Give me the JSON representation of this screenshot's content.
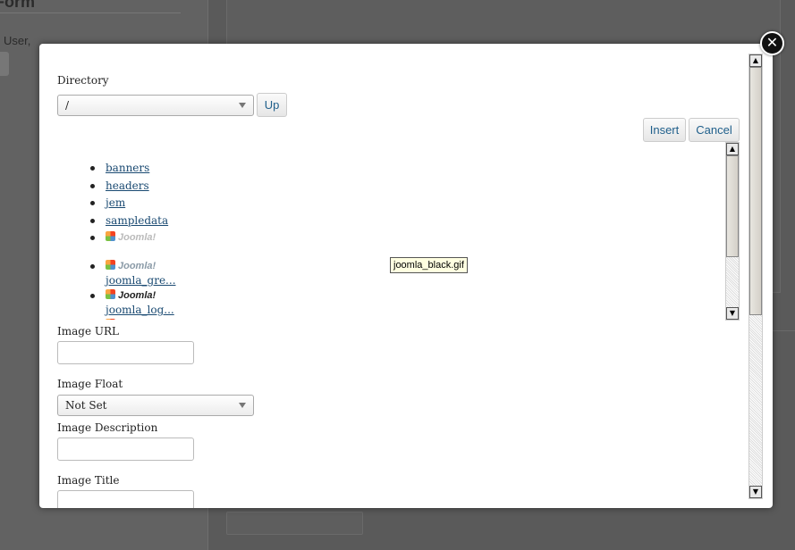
{
  "background": {
    "title": "Form",
    "user_text": "User,"
  },
  "modal": {
    "directory_label": "Directory",
    "directory_value": "/",
    "up_label": "Up",
    "insert_label": "Insert",
    "cancel_label": "Cancel",
    "folders": [
      "banners",
      "headers",
      "jem",
      "sampledata"
    ],
    "images": [
      {
        "name": "joomla_gre...",
        "logo": "Joomla!"
      },
      {
        "name": "joomla_log...",
        "logo": "Joomla!"
      }
    ],
    "logo_text": "Joomla!",
    "tooltip": "joomla_black.gif",
    "image_url_label": "Image URL",
    "image_url_value": "",
    "image_float_label": "Image Float",
    "image_float_value": "Not Set",
    "image_description_label": "Image Description",
    "image_description_value": "",
    "image_title_label": "Image Title",
    "image_title_value": ""
  },
  "icons": {
    "close": "close-icon",
    "dropdown": "chevron-down-icon",
    "scroll_up": "arrow-up-icon",
    "scroll_down": "arrow-down-icon"
  }
}
